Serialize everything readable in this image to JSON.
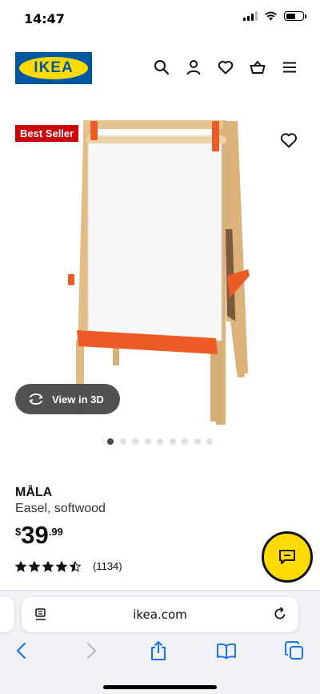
{
  "status_bar": {
    "time": "14:47",
    "battery_level": 0.55
  },
  "header": {
    "logo_text": "IKEA",
    "icons": [
      "search-icon",
      "account-icon",
      "heart-icon",
      "basket-icon",
      "menu-icon"
    ]
  },
  "product_image": {
    "badge": "Best Seller",
    "view_3d_label": "View in 3D",
    "image_count": 9,
    "active_image_index": 0
  },
  "product": {
    "name": "MÅLA",
    "description": "Easel, softwood",
    "price_currency": "$",
    "price_integer": "39",
    "price_decimal": ".99",
    "rating": 4.5,
    "review_count": "(1134)"
  },
  "browser": {
    "url": "ikea.com"
  },
  "colors": {
    "ikea_blue": "#0058a3",
    "ikea_yellow": "#ffdb00",
    "badge_red": "#cc0008",
    "easel_orange": "#ec5a25"
  }
}
